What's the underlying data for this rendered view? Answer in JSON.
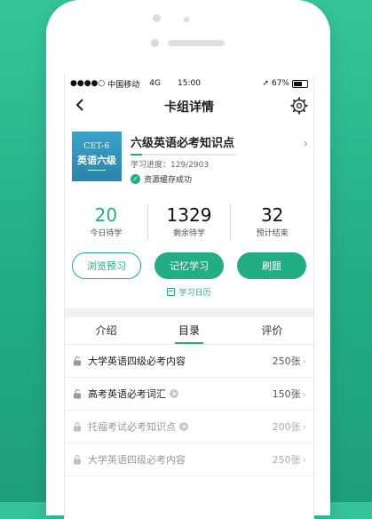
{
  "status": {
    "carrier": "中国移动",
    "network": "4G",
    "time": "15:00",
    "battery": "67%"
  },
  "nav": {
    "title": "卡组详情",
    "icons": [
      "chevron-left-icon",
      "gear-icon"
    ]
  },
  "card": {
    "cover_en": "CET-6",
    "cover_cn": "英语六级",
    "name": "六级英语必考知识点",
    "progress_label": "学习进度：129/2903",
    "progress_value": 129,
    "progress_total": 2903,
    "cached": "资源缓存成功"
  },
  "stats": [
    {
      "value": "20",
      "label": "今日待学",
      "color": "#22ad85"
    },
    {
      "value": "1329",
      "label": "剩余待学"
    },
    {
      "value": "32",
      "label": "预计结束"
    }
  ],
  "buttons": {
    "browse": "浏览预习",
    "memorize": "记忆学习",
    "drill": "刷题"
  },
  "calendar": "学习日历",
  "tabs": [
    "介绍",
    "目录",
    "评价"
  ],
  "active_tab": "目录",
  "list": [
    {
      "name": "大学英语四级必考内容",
      "count": "250张",
      "lock": "unlocked"
    },
    {
      "name": "高考英语必考词汇",
      "count": "150张",
      "lock": "unlocked",
      "play": true
    },
    {
      "name": "托福考试必考知识点",
      "count": "200张",
      "lock": "locked",
      "play": true
    },
    {
      "name": "大学英语四级必考内容",
      "count": "250张",
      "lock": "locked"
    }
  ],
  "colors": {
    "accent": "#22ad85",
    "background": "#2bb88e"
  }
}
